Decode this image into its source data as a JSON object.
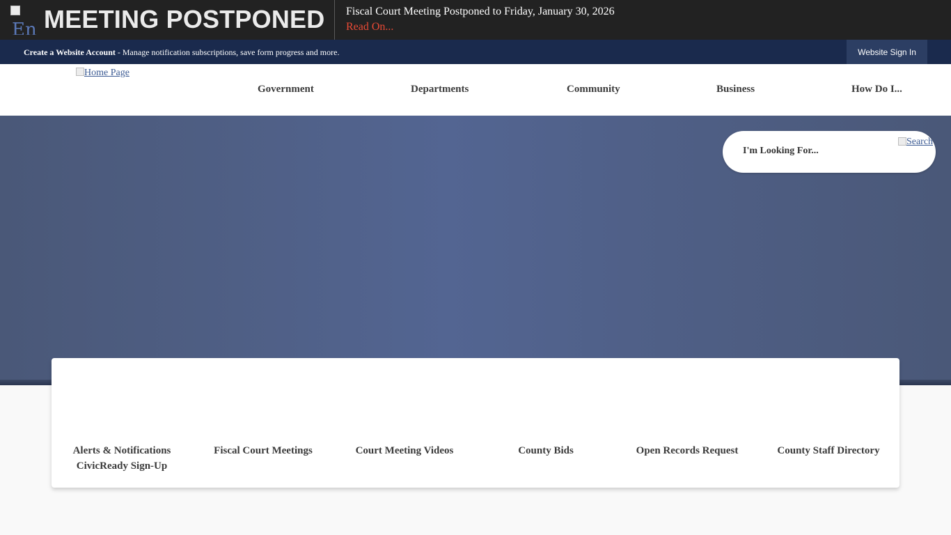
{
  "alert": {
    "image_alt": "En",
    "title": "MEETING POSTPONED",
    "message": "Fiscal Court Meeting Postponed to Friday, January 30, 2026",
    "read_on": "Read On..."
  },
  "account_bar": {
    "create_account": "Create a Website Account",
    "description": " - Manage notification subscriptions, save form progress and more.",
    "sign_in": "Website Sign In"
  },
  "header": {
    "logo_alt": "Home Page",
    "nav": [
      {
        "label": "Government"
      },
      {
        "label": "Departments"
      },
      {
        "label": "Community"
      },
      {
        "label": "Business"
      },
      {
        "label": "How Do I..."
      }
    ]
  },
  "search": {
    "label": "I'm Looking For...",
    "button_alt": "Search"
  },
  "quick_links": [
    {
      "label": "Alerts & Notifications CivicReady Sign-Up"
    },
    {
      "label": "Fiscal Court Meetings"
    },
    {
      "label": "Court Meeting Videos"
    },
    {
      "label": "County Bids"
    },
    {
      "label": "Open Records Request"
    },
    {
      "label": "County Staff Directory"
    }
  ]
}
